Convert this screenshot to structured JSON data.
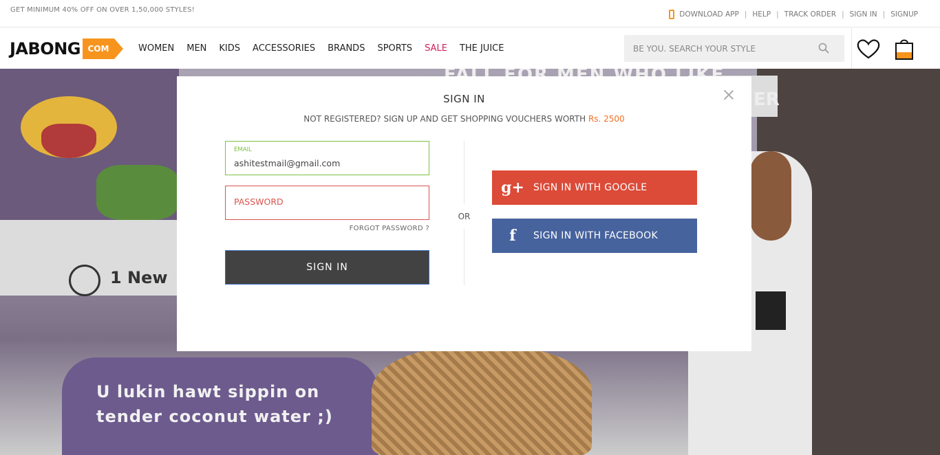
{
  "topbar": {
    "promo": "GET MINIMUM 40% OFF ON OVER 1,50,000 STYLES!",
    "links": [
      "DOWNLOAD APP",
      "HELP",
      "TRACK ORDER",
      "SIGN IN",
      "SIGNUP"
    ]
  },
  "header": {
    "logo_text": "JABONG",
    "logo_tag": "COM",
    "nav": [
      "WOMEN",
      "MEN",
      "KIDS",
      "ACCESSORIES",
      "BRANDS",
      "SPORTS",
      "SALE",
      "THE JUICE"
    ],
    "search_placeholder": "BE YOU. SEARCH YOUR STYLE"
  },
  "hero": {
    "whatsapp_text": "1 New",
    "slogan_line1": "U lukin hawt sippin on",
    "slogan_line2": "tender coconut water ;)",
    "poster_text": "FALL FOR MEN WHO LIKE",
    "poster_text2": "ER"
  },
  "modal": {
    "title": "SIGN IN",
    "subtitle_prefix": "NOT REGISTERED?  SIGN UP AND GET SHOPPING VOUCHERS WORTH ",
    "subtitle_amount": "Rs. 2500",
    "email_label": "EMAIL",
    "email_value": "ashitestmail@gmail.com",
    "password_placeholder": "PASSWORD",
    "forgot_label": "FORGOT PASSWORD ?",
    "signin_label": "SIGN IN",
    "or_label": "OR",
    "google_label": "SIGN IN WITH GOOGLE",
    "google_icon_glyph": "g+",
    "facebook_label": "SIGN IN WITH FACEBOOK",
    "facebook_icon_glyph": "f"
  },
  "colors": {
    "accent_orange": "#f7941e",
    "sale_pink": "#d0215c",
    "google_red": "#dc4a38",
    "facebook_blue": "#47639e",
    "email_green": "#7cc142",
    "error_red": "#d9534f"
  }
}
